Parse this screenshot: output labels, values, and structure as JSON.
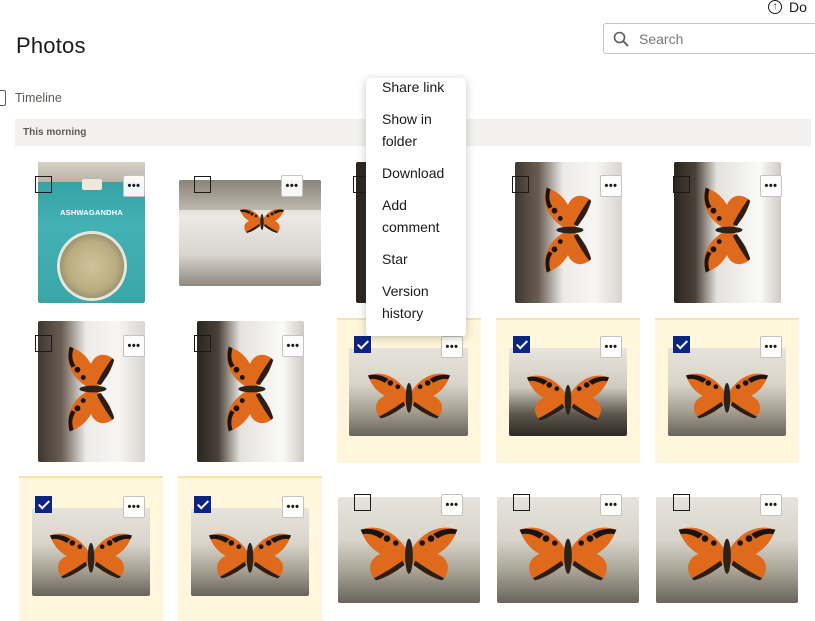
{
  "header": {
    "upload_label": "Do",
    "page_title": "Photos"
  },
  "search": {
    "placeholder": "Search"
  },
  "filters": {
    "timeline_label": "Timeline"
  },
  "section": {
    "title": "This morning"
  },
  "context_menu": {
    "items": [
      {
        "label": "Share link"
      },
      {
        "label": "Show in folder"
      },
      {
        "label": "Download"
      },
      {
        "label": "Add comment"
      },
      {
        "label": "Star"
      },
      {
        "label": "Version history"
      }
    ]
  },
  "photos": {
    "more_label": "•••",
    "items": [
      {
        "subject": "ashwagandha-package",
        "selected": false
      },
      {
        "subject": "butterfly-on-window",
        "selected": false
      },
      {
        "subject": "butterfly-dark",
        "selected": false
      },
      {
        "subject": "butterfly-vertical",
        "selected": false
      },
      {
        "subject": "butterfly-vertical",
        "selected": false
      },
      {
        "subject": "butterfly-vertical",
        "selected": false
      },
      {
        "subject": "butterfly-vertical",
        "selected": false
      },
      {
        "subject": "butterfly-wide",
        "selected": true
      },
      {
        "subject": "butterfly-wide",
        "selected": true
      },
      {
        "subject": "butterfly-wide",
        "selected": true
      },
      {
        "subject": "butterfly-wide",
        "selected": true
      },
      {
        "subject": "butterfly-wide",
        "selected": true
      },
      {
        "subject": "butterfly-wide",
        "selected": false
      },
      {
        "subject": "butterfly-wide",
        "selected": false
      },
      {
        "subject": "butterfly-wide",
        "selected": false
      }
    ],
    "package_text": "ASHWAGANDHA"
  },
  "colors": {
    "accent": "#0d2481",
    "selected_bg": "#fff6db",
    "section_bg": "#f2f1ef"
  }
}
